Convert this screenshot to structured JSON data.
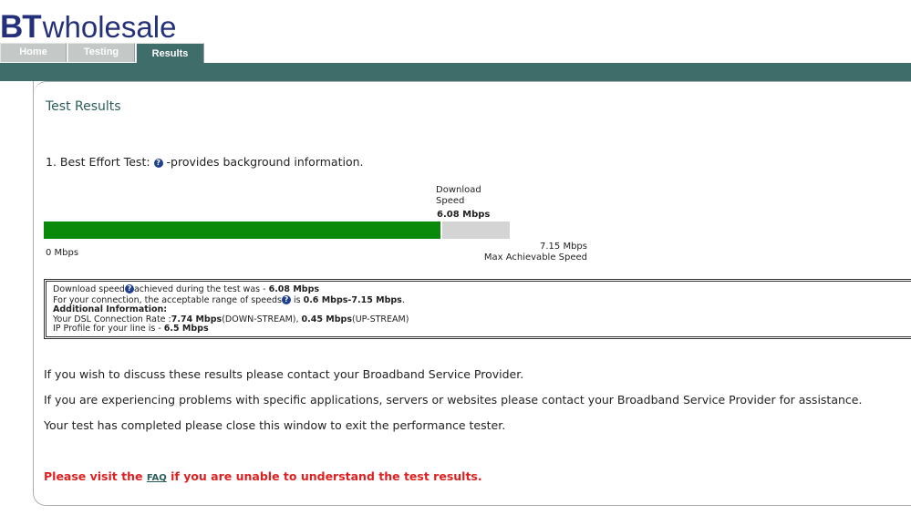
{
  "brand": {
    "logo_bold": "BT",
    "logo_rest": "wholesale"
  },
  "nav": {
    "tabs": [
      {
        "label": "Home",
        "active": false
      },
      {
        "label": "Testing",
        "active": false
      },
      {
        "label": "Results",
        "active": true
      }
    ]
  },
  "colors": {
    "brand_blue": "#24307a",
    "teal": "#3f6e6a",
    "progress_green": "#0a8a0a",
    "warning_red": "#e02020"
  },
  "main": {
    "title": "Test Results",
    "test_heading": "1. Best Effort Test:",
    "test_heading_suffix": "-provides background information.",
    "help_icon": "question-icon",
    "speed_meter": {
      "label": "Download Speed",
      "value_text": "6.08 Mbps",
      "value": 6.08,
      "max": 7.15,
      "min_label": "0 Mbps",
      "max_label": "7.15 Mbps",
      "max_caption": "Max Achievable Speed"
    },
    "info": {
      "line1_prefix": "Download speed",
      "line1_mid": "achieved during the test was - ",
      "line1_value": "6.08 Mbps",
      "line2_prefix": "For your connection, the acceptable range of speeds",
      "line2_mid": " is ",
      "line2_value": "0.6 Mbps-7.15 Mbps",
      "line2_end": ".",
      "additional_heading": "Additional Information:",
      "dsl_prefix": "Your DSL Connection Rate :",
      "dsl_down_value": "7.74 Mbps",
      "dsl_down_label": "(DOWN-STREAM), ",
      "dsl_up_value": "0.45 Mbps",
      "dsl_up_label": "(UP-STREAM)",
      "ip_prefix": "IP Profile for your line is - ",
      "ip_value": "6.5 Mbps"
    },
    "paragraphs": [
      "If you wish to discuss these results please contact your Broadband Service Provider.",
      "If you are experiencing problems with specific applications, servers or websites please contact your Broadband Service Provider for assistance.",
      "Your test has completed please close this window to exit the performance tester."
    ],
    "faq": {
      "prefix": "Please visit the ",
      "link": "FAQ",
      "suffix": " if you are unable to understand the test results."
    }
  }
}
